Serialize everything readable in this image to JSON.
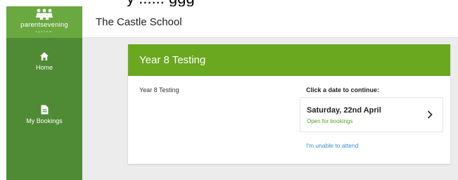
{
  "top_clipped_text": "y    ......  ggg",
  "app": {
    "logo_text": "parentsevening",
    "logo_subtext": "system"
  },
  "sidebar": {
    "items": [
      {
        "label": "Home",
        "icon": "home-icon"
      },
      {
        "label": "My Bookings",
        "icon": "document-icon"
      }
    ]
  },
  "header": {
    "school_name": "The Castle School"
  },
  "event": {
    "title": "Year 8 Testing",
    "description": "Year 8 Testing",
    "click_prompt": "Click a date to continue:",
    "dates": [
      {
        "date": "Saturday, 22nd April",
        "status": "Open for bookings"
      }
    ],
    "unable_link": "I'm unable to attend"
  },
  "colors": {
    "sidebar": "#4f8a34",
    "logo_bg": "#6aa840",
    "card_header": "#6aa820",
    "status_green": "#56a32a",
    "link_blue": "#3a8fd0"
  }
}
